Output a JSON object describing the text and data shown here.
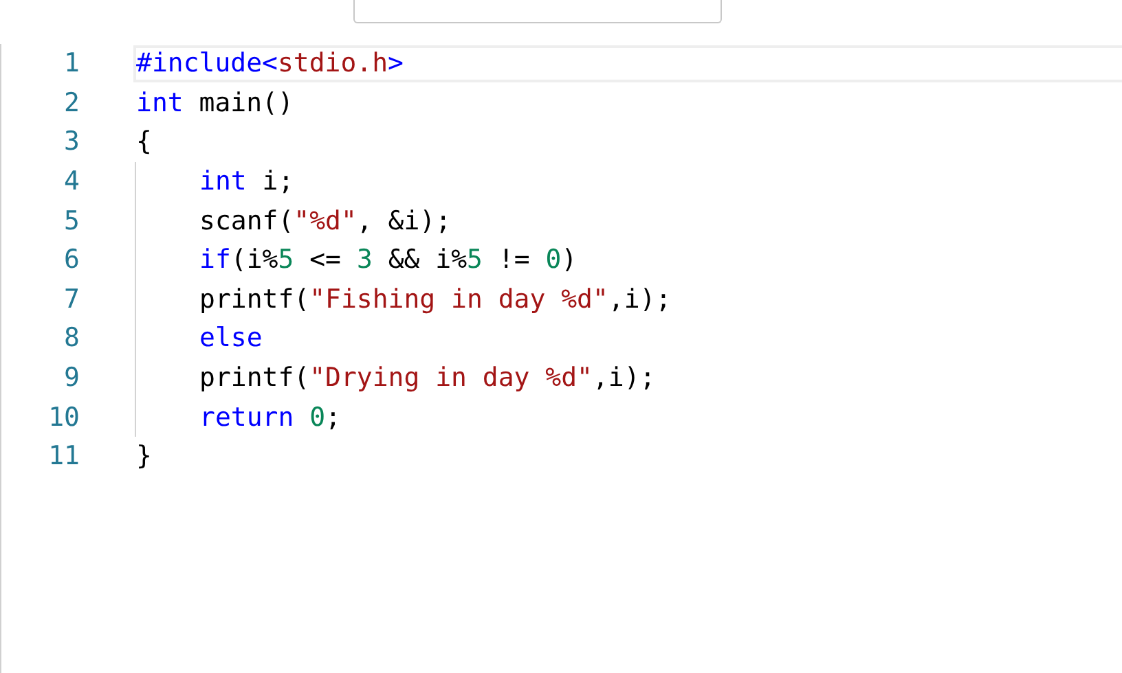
{
  "editor": {
    "lines": [
      {
        "number": "1",
        "current": true,
        "tokens": [
          {
            "kind": "keyword",
            "text": "#include"
          },
          {
            "kind": "keyword",
            "text": "<"
          },
          {
            "kind": "string",
            "text": "stdio.h"
          },
          {
            "kind": "keyword",
            "text": ">"
          }
        ]
      },
      {
        "number": "2",
        "current": false,
        "tokens": [
          {
            "kind": "keyword",
            "text": "int"
          },
          {
            "kind": "plain",
            "text": " main()"
          }
        ]
      },
      {
        "number": "3",
        "current": false,
        "tokens": [
          {
            "kind": "plain",
            "text": "{"
          }
        ],
        "children": [
          {
            "number": "4",
            "current": false,
            "tokens": [
              {
                "kind": "keyword",
                "text": "int"
              },
              {
                "kind": "plain",
                "text": " i;"
              }
            ]
          },
          {
            "number": "5",
            "current": false,
            "tokens": [
              {
                "kind": "plain",
                "text": "scanf("
              },
              {
                "kind": "string",
                "text": "\"%d\""
              },
              {
                "kind": "plain",
                "text": ", &i);"
              }
            ]
          },
          {
            "number": "6",
            "current": false,
            "tokens": [
              {
                "kind": "keyword",
                "text": "if"
              },
              {
                "kind": "plain",
                "text": "(i%"
              },
              {
                "kind": "number",
                "text": "5"
              },
              {
                "kind": "plain",
                "text": " <= "
              },
              {
                "kind": "number",
                "text": "3"
              },
              {
                "kind": "plain",
                "text": " && i%"
              },
              {
                "kind": "number",
                "text": "5"
              },
              {
                "kind": "plain",
                "text": " != "
              },
              {
                "kind": "number",
                "text": "0"
              },
              {
                "kind": "plain",
                "text": ")"
              }
            ]
          },
          {
            "number": "7",
            "current": false,
            "tokens": [
              {
                "kind": "plain",
                "text": "printf("
              },
              {
                "kind": "string",
                "text": "\"Fishing in day %d\""
              },
              {
                "kind": "plain",
                "text": ",i);"
              }
            ]
          },
          {
            "number": "8",
            "current": false,
            "tokens": [
              {
                "kind": "keyword",
                "text": "else"
              }
            ]
          },
          {
            "number": "9",
            "current": false,
            "tokens": [
              {
                "kind": "plain",
                "text": "printf("
              },
              {
                "kind": "string",
                "text": "\"Drying in day %d\""
              },
              {
                "kind": "plain",
                "text": ",i);"
              }
            ]
          },
          {
            "number": "10",
            "current": false,
            "tokens": [
              {
                "kind": "keyword",
                "text": "return "
              },
              {
                "kind": "number",
                "text": "0"
              },
              {
                "kind": "plain",
                "text": ";"
              }
            ]
          }
        ]
      },
      {
        "number": "11",
        "current": false,
        "tokens": [
          {
            "kind": "plain",
            "text": "}"
          }
        ]
      }
    ]
  }
}
